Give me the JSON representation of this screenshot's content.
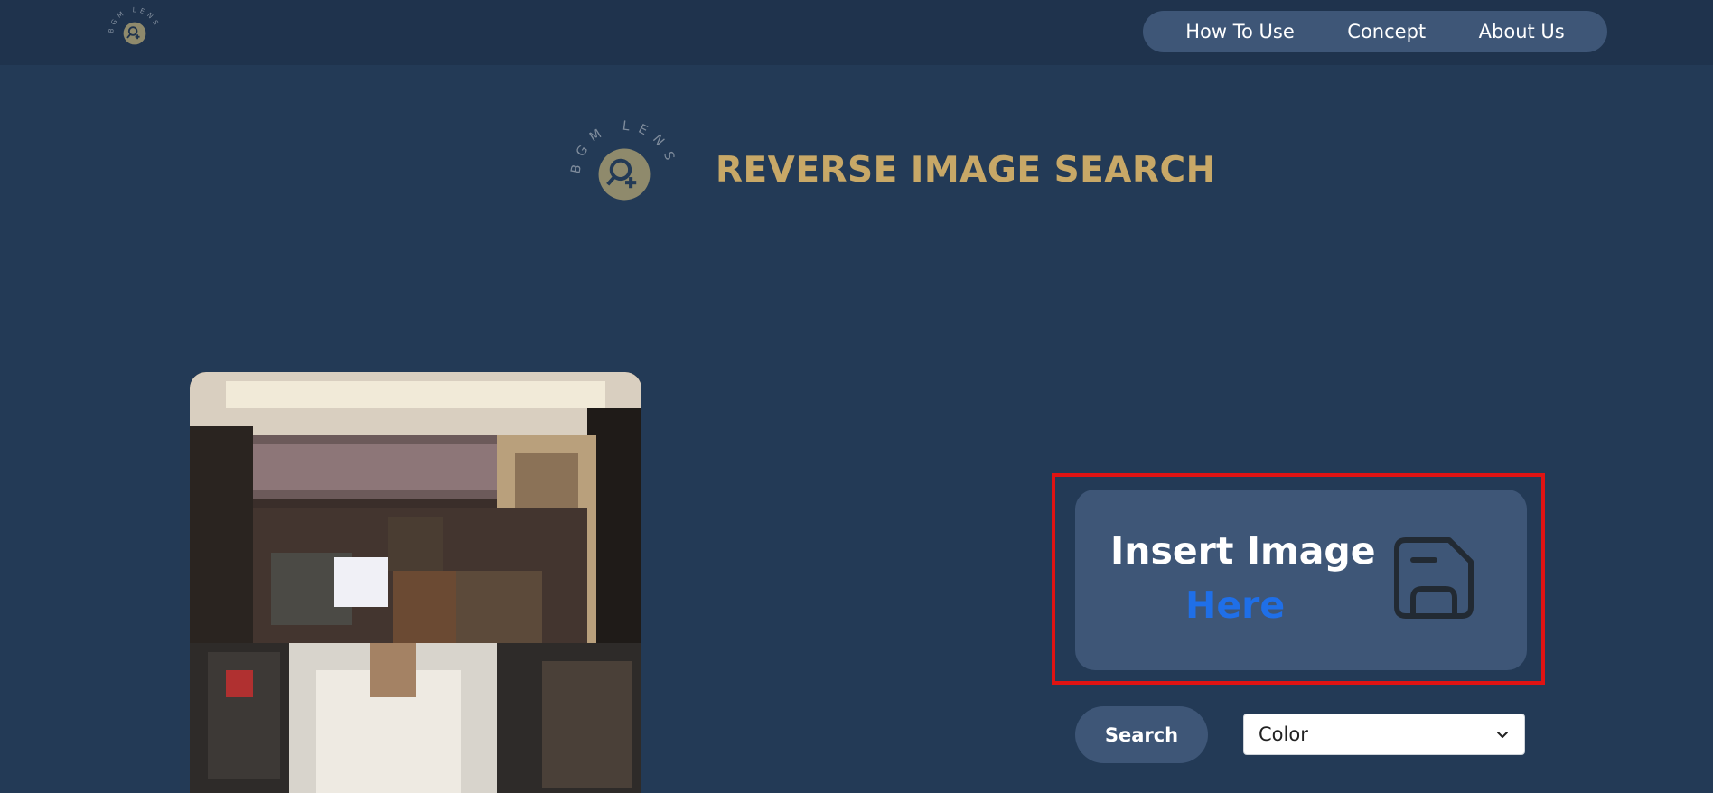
{
  "brand": {
    "logo_text": "BGM LENS",
    "title": "REVERSE IMAGE SEARCH"
  },
  "nav": {
    "items": [
      {
        "label": "How To Use"
      },
      {
        "label": "Concept"
      },
      {
        "label": "About Us"
      }
    ]
  },
  "upload": {
    "title": "Insert Image",
    "subtitle": "Here",
    "icon": "save-icon"
  },
  "controls": {
    "search_label": "Search",
    "select_value": "Color",
    "select_options": [
      "Color"
    ]
  },
  "colors": {
    "background": "#233a56",
    "topbar": "#1f334d",
    "pill": "#3e5677",
    "title_gold": "#c8a867",
    "accent_blue": "#1f6fe8",
    "highlight_red": "#e01313"
  }
}
